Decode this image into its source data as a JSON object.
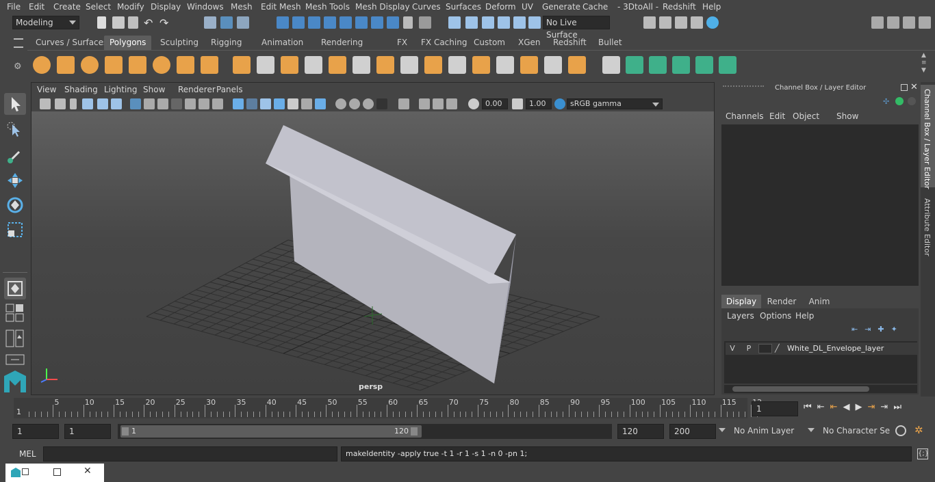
{
  "menu": [
    "File",
    "Edit",
    "Create",
    "Select",
    "Modify",
    "Display",
    "Windows",
    "Mesh",
    "Edit Mesh",
    "Mesh Tools",
    "Mesh Display",
    "Curves",
    "Surfaces",
    "Deform",
    "UV",
    "Generate",
    "Cache",
    "- 3DtoAll -",
    "Redshift",
    "Help"
  ],
  "toolbar": {
    "mode": "Modeling",
    "live_surface": "No Live Surface"
  },
  "shelf_tabs": [
    "Curves / Surfaces",
    "Polygons",
    "Sculpting",
    "Rigging",
    "Animation",
    "Rendering",
    "FX",
    "FX Caching",
    "Custom",
    "XGen",
    "Redshift",
    "Bullet"
  ],
  "shelf_active": "Polygons",
  "viewport": {
    "menu": [
      "View",
      "Shading",
      "Lighting",
      "Show",
      "Renderer",
      "Panels"
    ],
    "exposure": "0.00",
    "gamma": "1.00",
    "colorspace": "sRGB gamma",
    "camera": "persp"
  },
  "channel_box": {
    "title": "Channel Box / Layer Editor",
    "menu": [
      "Channels",
      "Edit",
      "Object",
      "Show"
    ],
    "layer_tabs": [
      "Display",
      "Render",
      "Anim"
    ],
    "layer_tab_active": "Display",
    "layer_menu": [
      "Layers",
      "Options",
      "Help"
    ],
    "layer": {
      "v": "V",
      "p": "P",
      "name": "White_DL_Envelope_layer"
    }
  },
  "side_tabs": [
    "Channel Box / Layer Editor",
    "Attribute Editor"
  ],
  "timeline": {
    "ticks": [
      "5",
      "10",
      "15",
      "20",
      "25",
      "30",
      "35",
      "40",
      "45",
      "50",
      "55",
      "60",
      "65",
      "70",
      "75",
      "80",
      "85",
      "90",
      "95",
      "100",
      "105",
      "110",
      "115",
      "12"
    ],
    "start_marker": "1",
    "current_frame": "1"
  },
  "range": {
    "start": "1",
    "anim_start": "1",
    "slider_min": "1",
    "slider_max": "120",
    "range_end": "120",
    "anim_end": "200",
    "anim_layer": "No Anim Layer",
    "char_set": "No Character Set"
  },
  "command": {
    "lang": "MEL",
    "result": "makeIdentity -apply true -t 1 -r 1 -s 1 -n 0 -pn 1;"
  },
  "colors": {
    "accent_blue": "#5a8fbd",
    "shelf_orange": "#e8a24a",
    "shelf_green": "#3fb08a"
  }
}
